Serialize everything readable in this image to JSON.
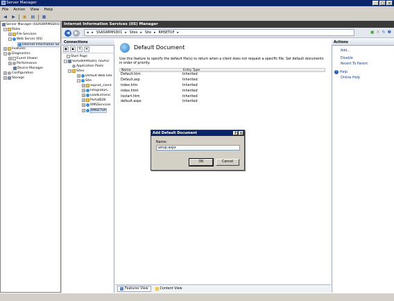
{
  "window": {
    "title": "Server Manager",
    "buttons": [
      "_",
      "□",
      "×"
    ]
  },
  "menubar": [
    "File",
    "Action",
    "View",
    "Help"
  ],
  "left_tree": {
    "items": [
      {
        "label": "Server Manager (SSASWRMSD01)",
        "level": 0
      },
      {
        "label": "Roles",
        "level": 1
      },
      {
        "label": "File Services",
        "level": 2
      },
      {
        "label": "Web Server (IIS)",
        "level": 2
      },
      {
        "label": "Internet Information Se",
        "level": 3,
        "selected": true
      },
      {
        "label": "Features",
        "level": 0
      },
      {
        "label": "Diagnostics",
        "level": 0
      },
      {
        "label": "Event Viewer",
        "level": 1
      },
      {
        "label": "Performance",
        "level": 1
      },
      {
        "label": "Device Manager",
        "level": 1
      },
      {
        "label": "Configuration",
        "level": 0
      },
      {
        "label": "Storage",
        "level": 0
      }
    ]
  },
  "iis": {
    "title": "Internet Information Services (IIS) Manager",
    "breadcrumbs": [
      "SSASWRMSD01",
      "Sites",
      "Site",
      "RMSETUP"
    ],
    "connections": {
      "header": "Connections",
      "items": [
        {
          "label": "Start Page",
          "level": 0
        },
        {
          "label": "SSASWRMSD01 (SSA\\U",
          "level": 0
        },
        {
          "label": "Application Pools",
          "level": 1
        },
        {
          "label": "Sites",
          "level": 1
        },
        {
          "label": "Default Web Site",
          "level": 2
        },
        {
          "label": "Site",
          "level": 2
        },
        {
          "label": "aspnet_client",
          "level": 3
        },
        {
          "label": "IntegratorC",
          "level": 3
        },
        {
          "label": "LoadExtronic",
          "level": 3
        },
        {
          "label": "PortalB2B",
          "level": 3
        },
        {
          "label": "RMSServices",
          "level": 3
        },
        {
          "label": "RMSETUP",
          "level": 3,
          "selected": true
        }
      ]
    },
    "feature": {
      "title": "Default Document",
      "description": "Use this feature to specify the default file(s) to return when a client does not request a specific file. Set default documents in order of priority.",
      "columns": [
        "Name",
        "Entry Type"
      ],
      "rows": [
        [
          "Default.htm",
          "Inherited"
        ],
        [
          "Default.asp",
          "Inherited"
        ],
        [
          "index.htm",
          "Inherited"
        ],
        [
          "index.html",
          "Inherited"
        ],
        [
          "iisstart.htm",
          "Inherited"
        ],
        [
          "default.aspx",
          "Inherited"
        ]
      ]
    },
    "view_tabs": [
      "Features View",
      "Content View"
    ],
    "actions": {
      "header": "Actions",
      "items": [
        "Add...",
        "Disable",
        "Revert To Parent",
        "Help",
        "Online Help"
      ]
    }
  },
  "dialog": {
    "title": "Add Default Document",
    "buttons": [
      "?",
      "×"
    ],
    "name_label": "Name:",
    "name_value": "Setup.aspx",
    "ok_label": "OK",
    "cancel_label": "Cancel"
  }
}
